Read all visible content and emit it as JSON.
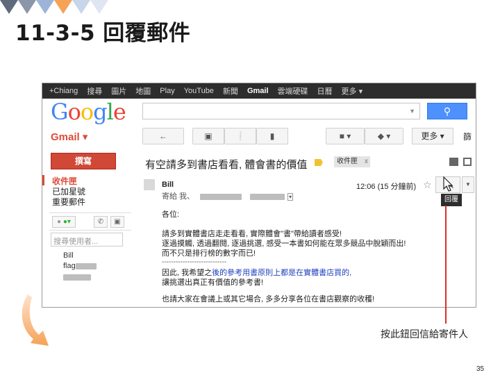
{
  "slide": {
    "title": "11-3-5 回覆郵件",
    "page_number": "35",
    "callout": "按此鈕回信給寄件人"
  },
  "gmail": {
    "topbar": [
      "+Chiang",
      "搜尋",
      "圖片",
      "地圖",
      "Play",
      "YouTube",
      "新聞",
      "Gmail",
      "雲端硬碟",
      "日曆",
      "更多 ▾"
    ],
    "active_tab": "Gmail",
    "logo_letters": [
      {
        "ch": "G",
        "color": "#4285f4"
      },
      {
        "ch": "o",
        "color": "#ea4335"
      },
      {
        "ch": "o",
        "color": "#fbbc05"
      },
      {
        "ch": "g",
        "color": "#4285f4"
      },
      {
        "ch": "l",
        "color": "#34a853"
      },
      {
        "ch": "e",
        "color": "#ea4335"
      }
    ],
    "search_button_icon": "search-icon",
    "gmail_label": "Gmail ▾",
    "more_button": "更多 ▾",
    "cut_button": "篩",
    "compose": "撰寫",
    "sidebar": [
      "收件匣",
      "已加星號",
      "重要郵件"
    ],
    "chat_search_placeholder": "搜尋使用者...",
    "contacts": [
      "Bill",
      "flag"
    ],
    "subject": "有空請多到書店看看, 體會書的價值",
    "label_chip": "收件匣",
    "label_chip_close": "x",
    "sender": "Bill",
    "to_line": "寄給 我、",
    "time": "12:06 (15 分鐘前)",
    "tooltip": "回覆",
    "body": {
      "greeting": "各位:",
      "p1": "請多到實體書店走走看看, 實際體會\"書\"帶給讀者感受!",
      "p2": "逐過摸觸, 透過翻閱, 逐過挑選, 感受一本書如何能在眾多競品中脫穎而出!",
      "p3": "而不只是排行榜的數字而已!",
      "dashes": "----------------------------",
      "p4_prefix": "因此, 我希望之",
      "p4_blue": "後的參考用書原則上都是在實體書店買的,",
      "p5": "讓挑選出真正有價值的參考書!",
      "p6": "也請大家在會議上或其它場合, 多多分享各位在書店觀察的收穫!"
    },
    "colors": {
      "accent_red": "#dd4b39",
      "search_blue": "#4d90fe",
      "topbar_bg": "#2d2d2d"
    }
  }
}
